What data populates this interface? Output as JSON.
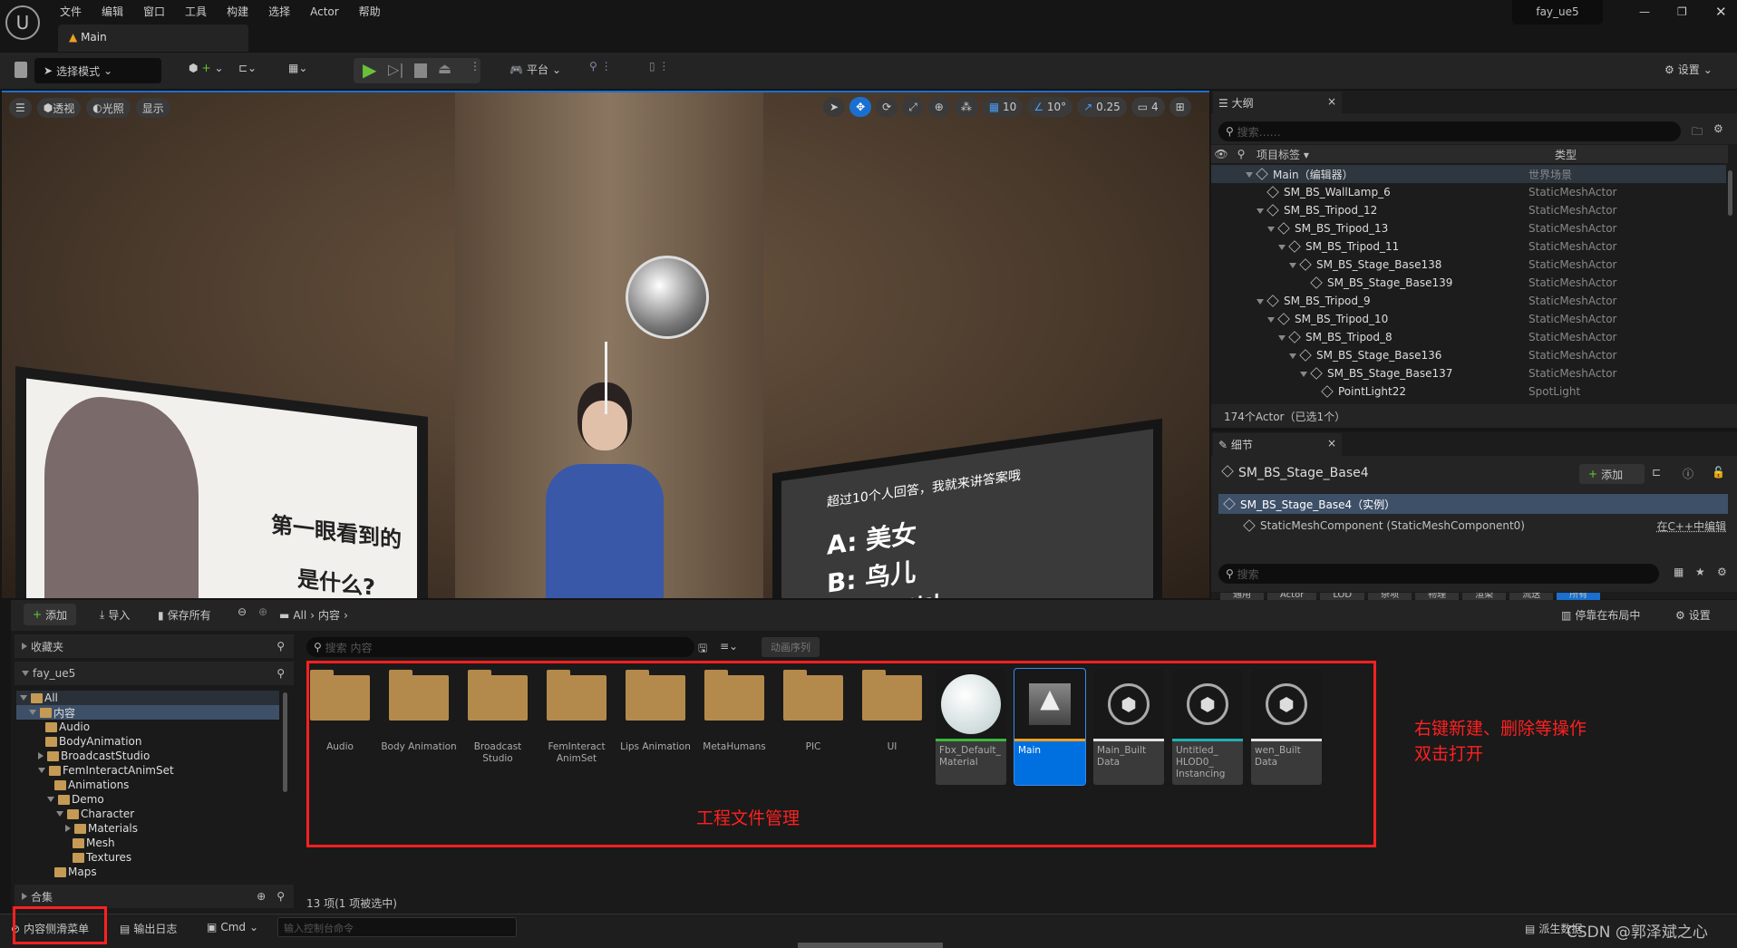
{
  "title_bar": {
    "menu": [
      "文件",
      "编辑",
      "窗口",
      "工具",
      "构建",
      "选择",
      "Actor",
      "帮助"
    ],
    "project": "fay_ue5",
    "tab": "Main"
  },
  "toolbar": {
    "mode": "选择模式",
    "platform": "平台",
    "settings": "设置"
  },
  "viewport": {
    "buttons": [
      "透视",
      "光照",
      "显示"
    ],
    "grid": "10",
    "angle": "10°",
    "scale": "0.25",
    "camera": "4",
    "board_left": [
      "第一眼看到的",
      "是什么?"
    ],
    "board_right": {
      "caption": "超过10个人回答，我就来讲答案哦",
      "options": [
        "A: 美女",
        "B: 鸟儿",
        "C: 一棵树"
      ]
    }
  },
  "outliner": {
    "tab": "大纲",
    "search_placeholder": "搜索……",
    "col_label": "项目标签",
    "col_type": "类型",
    "rows": [
      {
        "name": "Main（编辑器）",
        "type": "世界场景",
        "depth": 0,
        "exp": true
      },
      {
        "name": "SM_BS_WallLamp_6",
        "type": "StaticMeshActor",
        "depth": 1,
        "exp": false
      },
      {
        "name": "SM_BS_Tripod_12",
        "type": "StaticMeshActor",
        "depth": 1,
        "exp": true
      },
      {
        "name": "SM_BS_Tripod_13",
        "type": "StaticMeshActor",
        "depth": 2,
        "exp": true
      },
      {
        "name": "SM_BS_Tripod_11",
        "type": "StaticMeshActor",
        "depth": 3,
        "exp": true
      },
      {
        "name": "SM_BS_Stage_Base138",
        "type": "StaticMeshActor",
        "depth": 4,
        "exp": true
      },
      {
        "name": "SM_BS_Stage_Base139",
        "type": "StaticMeshActor",
        "depth": 5,
        "exp": false
      },
      {
        "name": "SM_BS_Tripod_9",
        "type": "StaticMeshActor",
        "depth": 1,
        "exp": true
      },
      {
        "name": "SM_BS_Tripod_10",
        "type": "StaticMeshActor",
        "depth": 2,
        "exp": true
      },
      {
        "name": "SM_BS_Tripod_8",
        "type": "StaticMeshActor",
        "depth": 3,
        "exp": true
      },
      {
        "name": "SM_BS_Stage_Base136",
        "type": "StaticMeshActor",
        "depth": 4,
        "exp": true
      },
      {
        "name": "SM_BS_Stage_Base137",
        "type": "StaticMeshActor",
        "depth": 5,
        "exp": true
      },
      {
        "name": "PointLight22",
        "type": "SpotLight",
        "depth": 6,
        "exp": false
      }
    ],
    "footer": "174个Actor（已选1个）"
  },
  "details": {
    "tab": "细节",
    "object": "SM_BS_Stage_Base4",
    "add": "添加",
    "instance": "SM_BS_Stage_Base4（实例）",
    "component": "StaticMeshComponent (StaticMeshComponent0)",
    "edit_cpp": "在C++中编辑",
    "search_placeholder": "搜索",
    "tabs": [
      "通用",
      "Actor",
      "LOD",
      "杂项",
      "物理",
      "渲染",
      "流送",
      "所有"
    ]
  },
  "content": {
    "add": "添加",
    "import": "导入",
    "save_all": "保存所有",
    "path": [
      "All",
      "内容"
    ],
    "dock": "停靠在布局中",
    "settings": "设置",
    "favorites": "收藏夹",
    "project": "fay_ue5",
    "collections": "合集",
    "tree": [
      {
        "n": "All",
        "d": 0
      },
      {
        "n": "内容",
        "d": 1
      },
      {
        "n": "Audio",
        "d": 2
      },
      {
        "n": "BodyAnimation",
        "d": 2
      },
      {
        "n": "BroadcastStudio",
        "d": 2
      },
      {
        "n": "FemInteractAnimSet",
        "d": 2
      },
      {
        "n": "Animations",
        "d": 3
      },
      {
        "n": "Demo",
        "d": 3
      },
      {
        "n": "Character",
        "d": 4
      },
      {
        "n": "Materials",
        "d": 5
      },
      {
        "n": "Mesh",
        "d": 5
      },
      {
        "n": "Textures",
        "d": 5
      },
      {
        "n": "Maps",
        "d": 3
      }
    ],
    "search_placeholder": "搜索 内容",
    "filter": "动画序列",
    "folders": [
      "Audio",
      "Body Animation",
      "Broadcast Studio",
      "FemInteract AnimSet",
      "Lips Animation",
      "MetaHumans",
      "PIC",
      "UI"
    ],
    "assets": [
      {
        "n": "Fbx_Default_ Material",
        "c": "#3ab83a"
      },
      {
        "n": "Main",
        "c": "#f0a020"
      },
      {
        "n": "Main_Built Data",
        "c": "#e0e0e0"
      },
      {
        "n": "Untitled_ HLOD0_ Instancing",
        "c": "#20b0b0"
      },
      {
        "n": "wen_Built Data",
        "c": "#e0e0e0"
      }
    ],
    "status": "13 项(1 项被选中)",
    "annotation_main": "工程文件管理",
    "annotation_side": [
      "右键新建、删除等操作",
      "双击打开"
    ]
  },
  "bottom": {
    "drawer": "内容侧滑菜单",
    "log": "输出日志",
    "cmd": "Cmd",
    "cmd_placeholder": "输入控制台命令",
    "derived": "派生数据",
    "watermark": "CSDN @郭泽斌之心"
  },
  "colors": {
    "accent": "#0070e0",
    "annotation": "#ff2020"
  }
}
